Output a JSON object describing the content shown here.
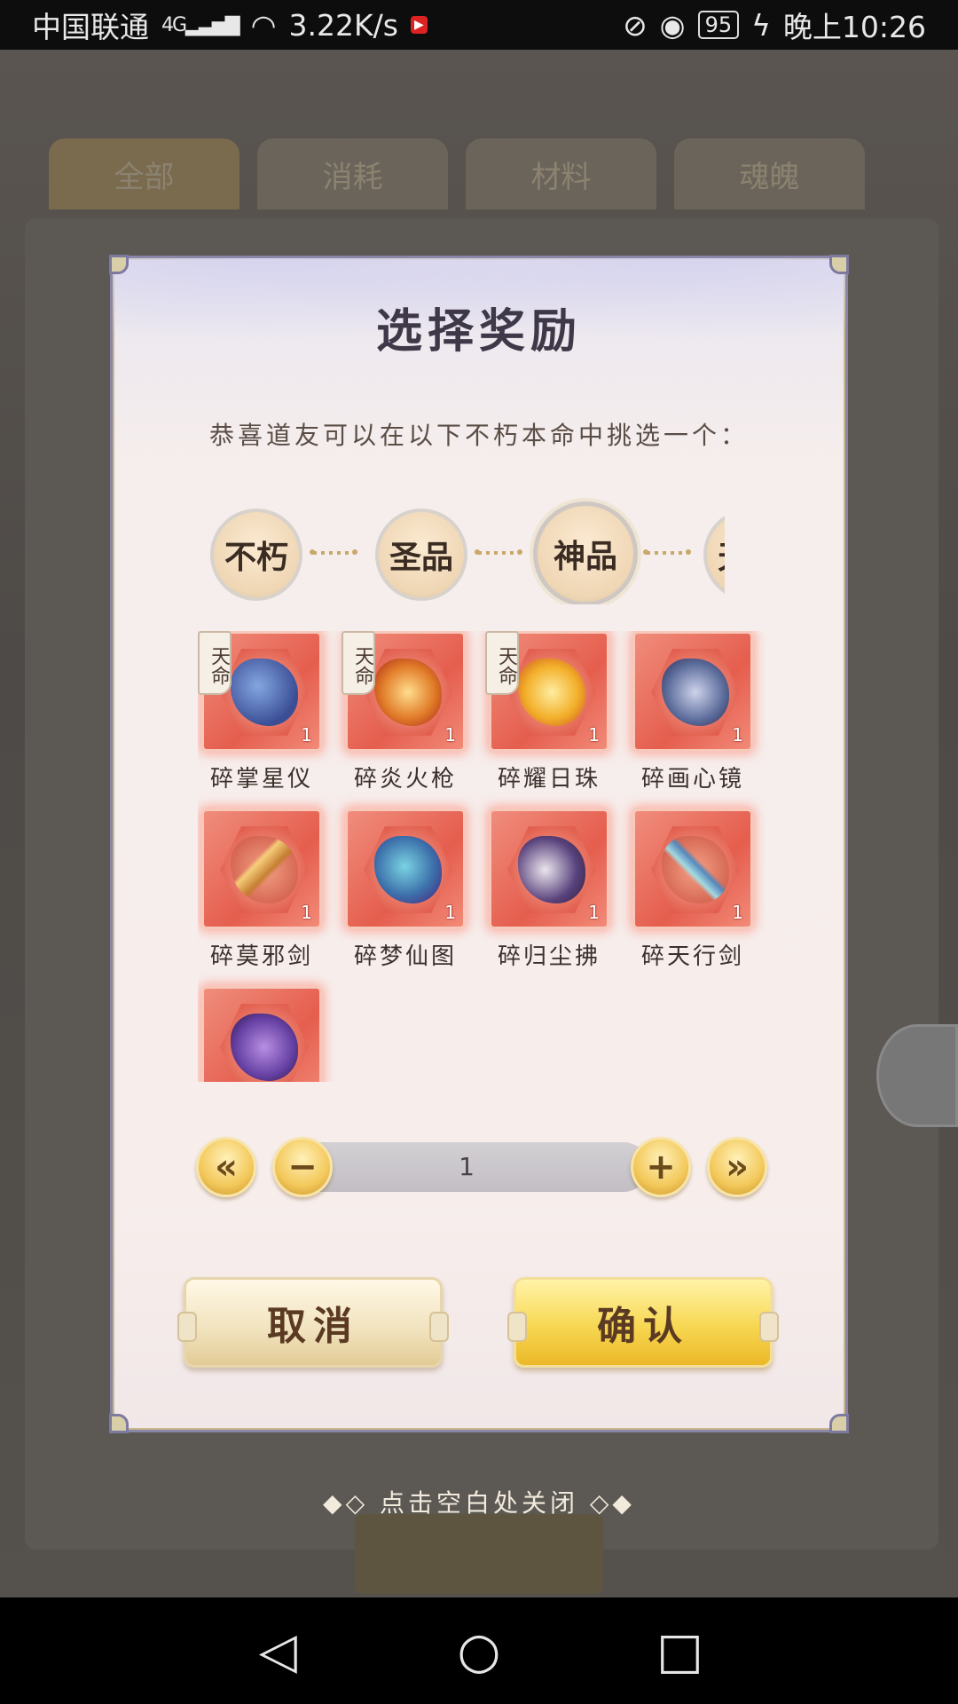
{
  "status_bar": {
    "carrier": "中国联通",
    "network": "4G",
    "speed": "3.22K/s",
    "battery": "95",
    "time": "晚上10:26"
  },
  "background": {
    "tabs": [
      "全部",
      "消耗",
      "材料",
      "魂魄"
    ]
  },
  "dialog": {
    "title": "选择奖励",
    "subtitle": "恭喜道友可以在以下不朽本命中挑选一个：",
    "rarity_tabs": [
      {
        "label": "不朽",
        "active": false
      },
      {
        "label": "圣品",
        "active": false
      },
      {
        "label": "神品",
        "active": true
      },
      {
        "label": "天命",
        "active": false
      }
    ],
    "items": [
      {
        "name": "碎掌星仪",
        "count": "1",
        "tag": "天命",
        "icon": "star-instrument-icon"
      },
      {
        "name": "碎炎火枪",
        "count": "1",
        "tag": "天命",
        "icon": "fire-spear-icon"
      },
      {
        "name": "碎耀日珠",
        "count": "1",
        "tag": "天命",
        "icon": "sun-pearl-icon"
      },
      {
        "name": "碎画心镜",
        "count": "1",
        "tag": "",
        "icon": "heart-mirror-icon"
      },
      {
        "name": "碎莫邪剑",
        "count": "1",
        "tag": "",
        "icon": "moye-sword-icon"
      },
      {
        "name": "碎梦仙图",
        "count": "1",
        "tag": "",
        "icon": "dream-scroll-icon"
      },
      {
        "name": "碎归尘拂",
        "count": "1",
        "tag": "",
        "icon": "dust-whisk-icon"
      },
      {
        "name": "碎天行剑",
        "count": "1",
        "tag": "",
        "icon": "sky-sword-icon"
      },
      {
        "name": "",
        "count": "",
        "tag": "",
        "icon": "purple-artifact-icon"
      }
    ],
    "quantity": {
      "value": "1",
      "first_label": "«",
      "minus_label": "−",
      "plus_label": "+",
      "last_label": "»"
    },
    "cancel_label": "取消",
    "confirm_label": "确认"
  },
  "close_hint": "◆◇ 点击空白处关闭 ◇◆",
  "nav_bar": {
    "back": "◁",
    "home": "○",
    "recents": "□"
  },
  "colors": {
    "item_card": "#e55e4e",
    "confirm_button": "#f7d752",
    "cancel_button": "#f1e2bd",
    "dialog_bg": "#f6eeec"
  }
}
